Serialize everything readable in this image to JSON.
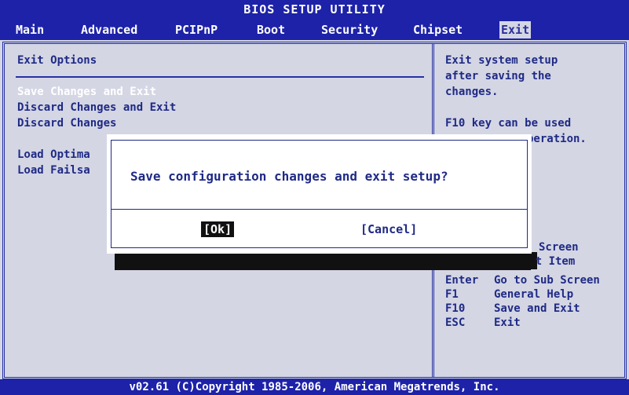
{
  "window": {
    "title": "BIOS SETUP UTILITY"
  },
  "menu": [
    "Main",
    "Advanced",
    "PCIPnP",
    "Boot",
    "Security",
    "Chipset",
    "Exit"
  ],
  "left": {
    "heading": "Exit Options",
    "items": [
      "Save Changes and Exit",
      "Discard Changes and Exit",
      "Discard Changes",
      "Load Optima",
      "Load Failsa"
    ]
  },
  "help": {
    "lines": [
      "Exit system setup",
      "after saving the",
      "changes.",
      "F10 key can be used",
      "peration."
    ]
  },
  "keys": [
    {
      "key": "",
      "desc": "Screen"
    },
    {
      "key": "↑↓",
      "desc": "Sel t Item"
    },
    {
      "key": "Enter",
      "desc": "Go to Sub Screen"
    },
    {
      "key": "F1",
      "desc": "General Help"
    },
    {
      "key": "F10",
      "desc": "Save and Exit"
    },
    {
      "key": "ESC",
      "desc": "Exit"
    }
  ],
  "dialog": {
    "question": "Save configuration changes and exit setup?",
    "ok_label": "[Ok]",
    "cancel_label": "[Cancel]"
  },
  "footer": {
    "text": "v02.61 (C)Copyright 1985-2006, American Megatrends, Inc."
  }
}
